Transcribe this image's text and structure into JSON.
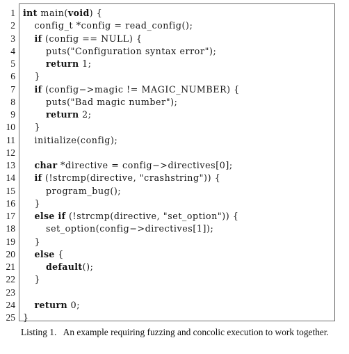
{
  "figure": {
    "kind": "code-listing",
    "frame_border_color": "#6b6b6b",
    "background_color": "#ffffff",
    "text_color": "#111111"
  },
  "code": {
    "language": "C",
    "first_line_number": 1,
    "last_line_number": 25,
    "lines": [
      {
        "num": "1",
        "indent": 0,
        "tokens": [
          {
            "t": "kw",
            "s": "int"
          },
          {
            "t": "pl",
            "s": " main("
          },
          {
            "t": "kw",
            "s": "void"
          },
          {
            "t": "pl",
            "s": ") {"
          }
        ]
      },
      {
        "num": "2",
        "indent": 1,
        "tokens": [
          {
            "t": "pl",
            "s": "config_t *config = read_config();"
          }
        ]
      },
      {
        "num": "3",
        "indent": 1,
        "tokens": [
          {
            "t": "kw",
            "s": "if"
          },
          {
            "t": "pl",
            "s": " (config == NULL) {"
          }
        ]
      },
      {
        "num": "4",
        "indent": 2,
        "tokens": [
          {
            "t": "pl",
            "s": "puts(\"Configuration syntax error\");"
          }
        ]
      },
      {
        "num": "5",
        "indent": 2,
        "tokens": [
          {
            "t": "kw",
            "s": "return"
          },
          {
            "t": "pl",
            "s": " 1;"
          }
        ]
      },
      {
        "num": "6",
        "indent": 1,
        "tokens": [
          {
            "t": "pl",
            "s": "}"
          }
        ]
      },
      {
        "num": "7",
        "indent": 1,
        "tokens": [
          {
            "t": "kw",
            "s": "if"
          },
          {
            "t": "pl",
            "s": " (config−>magic != MAGIC_NUMBER) {"
          }
        ]
      },
      {
        "num": "8",
        "indent": 2,
        "tokens": [
          {
            "t": "pl",
            "s": "puts(\"Bad magic number\");"
          }
        ]
      },
      {
        "num": "9",
        "indent": 2,
        "tokens": [
          {
            "t": "kw",
            "s": "return"
          },
          {
            "t": "pl",
            "s": " 2;"
          }
        ]
      },
      {
        "num": "10",
        "indent": 1,
        "tokens": [
          {
            "t": "pl",
            "s": "}"
          }
        ]
      },
      {
        "num": "11",
        "indent": 1,
        "tokens": [
          {
            "t": "pl",
            "s": "initialize(config);"
          }
        ]
      },
      {
        "num": "12",
        "indent": 0,
        "tokens": []
      },
      {
        "num": "13",
        "indent": 1,
        "tokens": [
          {
            "t": "kw",
            "s": "char"
          },
          {
            "t": "pl",
            "s": " *directive = config−>directives[0];"
          }
        ]
      },
      {
        "num": "14",
        "indent": 1,
        "tokens": [
          {
            "t": "kw",
            "s": "if"
          },
          {
            "t": "pl",
            "s": " (!strcmp(directive, \"crashstring\")) {"
          }
        ]
      },
      {
        "num": "15",
        "indent": 2,
        "tokens": [
          {
            "t": "pl",
            "s": "program_bug();"
          }
        ]
      },
      {
        "num": "16",
        "indent": 1,
        "tokens": [
          {
            "t": "pl",
            "s": "}"
          }
        ]
      },
      {
        "num": "17",
        "indent": 1,
        "tokens": [
          {
            "t": "kw",
            "s": "else if"
          },
          {
            "t": "pl",
            "s": " (!strcmp(directive, \"set_option\")) {"
          }
        ]
      },
      {
        "num": "18",
        "indent": 2,
        "tokens": [
          {
            "t": "pl",
            "s": "set_option(config−>directives[1]);"
          }
        ]
      },
      {
        "num": "19",
        "indent": 1,
        "tokens": [
          {
            "t": "pl",
            "s": "}"
          }
        ]
      },
      {
        "num": "20",
        "indent": 1,
        "tokens": [
          {
            "t": "kw",
            "s": "else"
          },
          {
            "t": "pl",
            "s": " {"
          }
        ]
      },
      {
        "num": "21",
        "indent": 2,
        "tokens": [
          {
            "t": "kw",
            "s": "default"
          },
          {
            "t": "pl",
            "s": "();"
          }
        ]
      },
      {
        "num": "22",
        "indent": 1,
        "tokens": [
          {
            "t": "pl",
            "s": "}"
          }
        ]
      },
      {
        "num": "23",
        "indent": 0,
        "tokens": []
      },
      {
        "num": "24",
        "indent": 1,
        "tokens": [
          {
            "t": "kw",
            "s": "return"
          },
          {
            "t": "pl",
            "s": " 0;"
          }
        ]
      },
      {
        "num": "25",
        "indent": 0,
        "tokens": [
          {
            "t": "pl",
            "s": "}"
          }
        ]
      }
    ]
  },
  "caption": {
    "label": "Listing 1.",
    "separator": "   ",
    "text": "An example requiring fuzzing and concolic execution to work together."
  }
}
